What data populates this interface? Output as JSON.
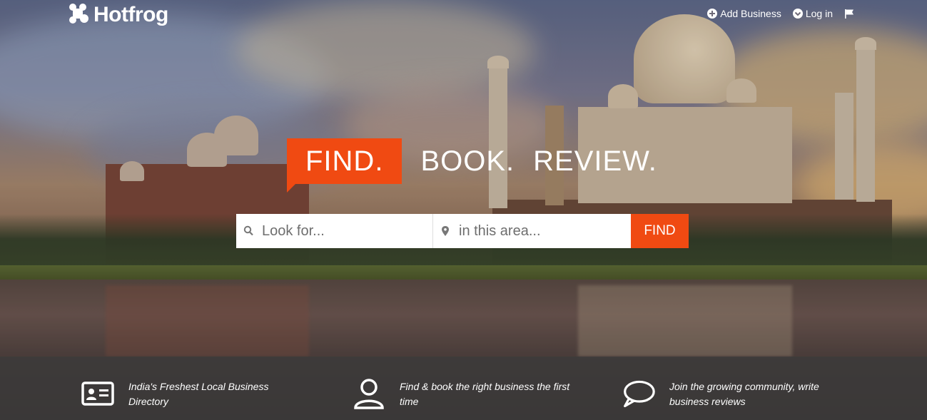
{
  "brand": {
    "name": "Hotfrog",
    "accent": "#f04a12"
  },
  "nav": {
    "add_business": "Add Business",
    "login": "Log in",
    "icons": [
      "plus-circle-icon",
      "chevron-down-circle-icon",
      "flag-icon"
    ]
  },
  "tagline": {
    "find": "FIND.",
    "book": "BOOK.",
    "review": "REVIEW."
  },
  "search": {
    "what_placeholder": "Look for...",
    "where_placeholder": "in this area...",
    "button_label": "FIND"
  },
  "features": [
    {
      "icon": "id-card-icon",
      "text": "India's Freshest Local Business Directory"
    },
    {
      "icon": "user-icon",
      "text": "Find & book the right business the first time"
    },
    {
      "icon": "speech-bubble-icon",
      "text": "Join the growing community, write business reviews"
    }
  ]
}
